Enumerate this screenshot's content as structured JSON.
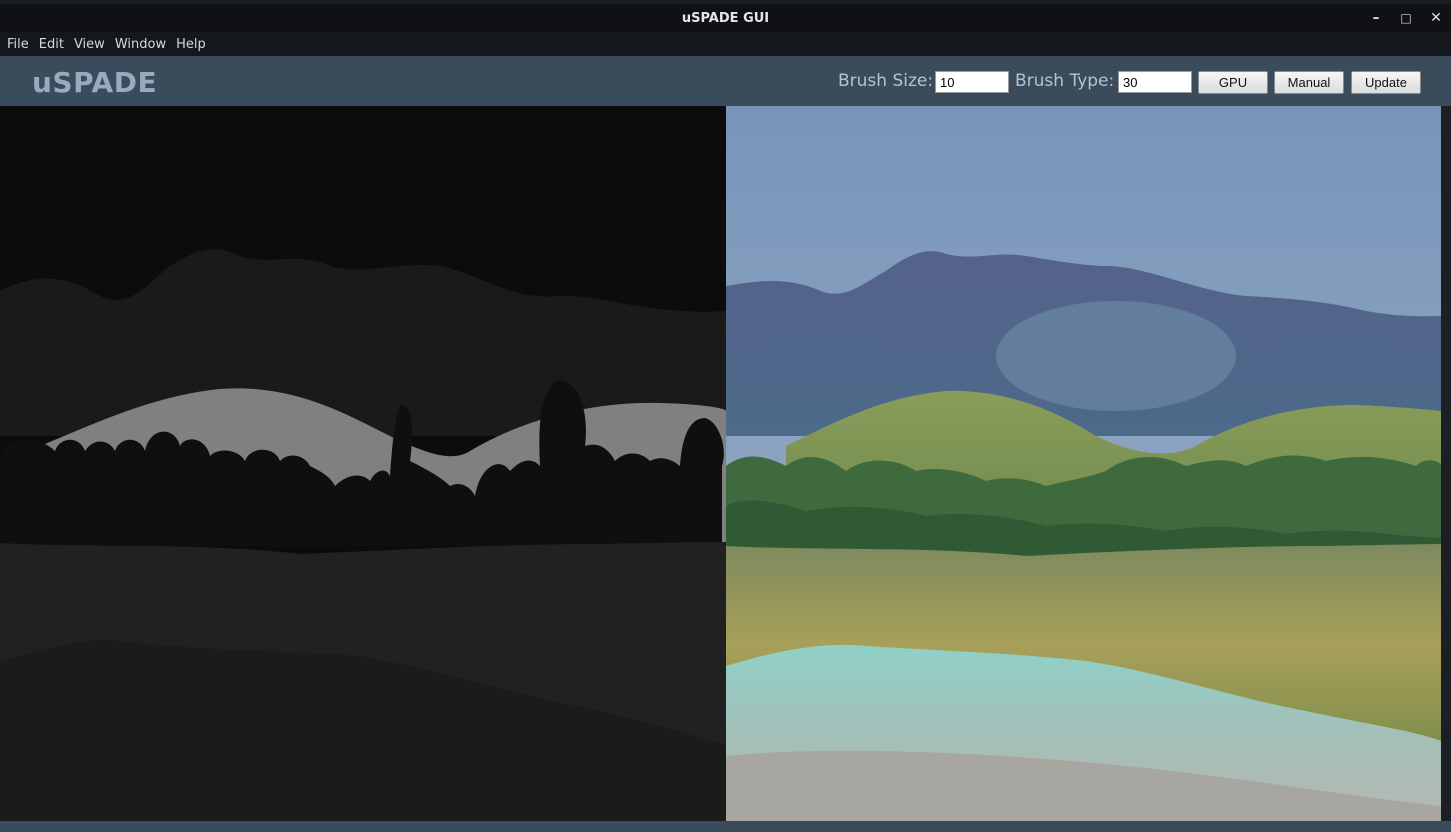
{
  "window": {
    "title": "uSPADE GUI",
    "controls": {
      "minimize": "–",
      "maximize": "□",
      "close": "✕"
    }
  },
  "menu": {
    "items": [
      "File",
      "Edit",
      "View",
      "Window",
      "Help"
    ]
  },
  "toolbar": {
    "logo": "uSPADE",
    "brush_size_label": "Brush Size:",
    "brush_size_value": "10",
    "brush_type_label": "Brush Type:",
    "brush_type_value": "30",
    "gpu_label": "GPU",
    "manual_label": "Manual",
    "update_label": "Update"
  },
  "colors": {
    "toolbar_bg": "#3a4b5c",
    "titlebar_bg": "#0f1114",
    "sky_label": "#0c0c0c",
    "mountain_label": "#1a1a1a",
    "hill_label": "#808080",
    "tree_label": "#0f0f0f",
    "grass_label": "#212121"
  }
}
